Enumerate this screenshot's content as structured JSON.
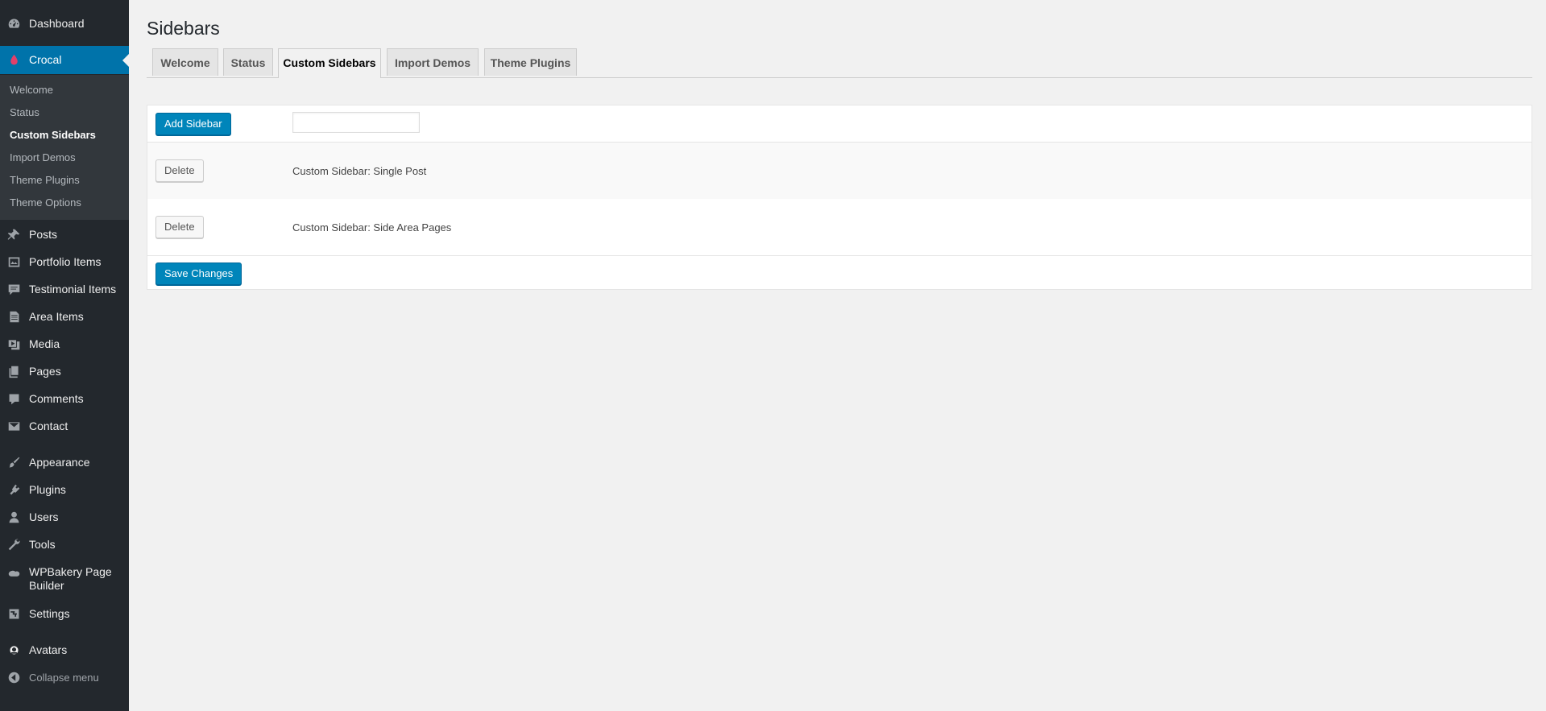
{
  "sidebar": {
    "items": [
      {
        "label": "Dashboard",
        "icon": "dashboard-icon"
      },
      {
        "label": "Crocal",
        "icon": "crocal-icon"
      },
      {
        "label": "Posts",
        "icon": "pushpin-icon"
      },
      {
        "label": "Portfolio Items",
        "icon": "portfolio-icon"
      },
      {
        "label": "Testimonial Items",
        "icon": "testimonial-icon"
      },
      {
        "label": "Area Items",
        "icon": "page-icon"
      },
      {
        "label": "Media",
        "icon": "media-icon"
      },
      {
        "label": "Pages",
        "icon": "pages-icon"
      },
      {
        "label": "Comments",
        "icon": "comment-icon"
      },
      {
        "label": "Contact",
        "icon": "envelope-icon"
      },
      {
        "label": "Appearance",
        "icon": "brush-icon"
      },
      {
        "label": "Plugins",
        "icon": "plugin-icon"
      },
      {
        "label": "Users",
        "icon": "user-icon"
      },
      {
        "label": "Tools",
        "icon": "wrench-icon"
      },
      {
        "label": "WPBakery Page Builder",
        "icon": "wpbakery-icon"
      },
      {
        "label": "Settings",
        "icon": "settings-icon"
      },
      {
        "label": "Avatars",
        "icon": "avatar-icon"
      },
      {
        "label": "Collapse menu",
        "icon": "collapse-icon"
      }
    ],
    "submenu": [
      "Welcome",
      "Status",
      "Custom Sidebars",
      "Import Demos",
      "Theme Plugins",
      "Theme Options"
    ],
    "current_item": "Crocal",
    "current_subitem": "Custom Sidebars"
  },
  "page": {
    "title": "Sidebars"
  },
  "tabs": [
    "Welcome",
    "Status",
    "Custom Sidebars",
    "Import Demos",
    "Theme Plugins"
  ],
  "active_tab": "Custom Sidebars",
  "form": {
    "add_button": "Add Sidebar",
    "name_input_value": "",
    "rows": [
      {
        "delete_label": "Delete",
        "name": "Custom Sidebar: Single Post"
      },
      {
        "delete_label": "Delete",
        "name": "Custom Sidebar: Side Area Pages"
      }
    ],
    "save_button": "Save Changes"
  },
  "colors": {
    "menu_bg": "#23282d",
    "submenu_bg": "#32373c",
    "accent": "#0073aa",
    "button_primary": "#0085ba",
    "page_bg": "#f1f1f1"
  }
}
